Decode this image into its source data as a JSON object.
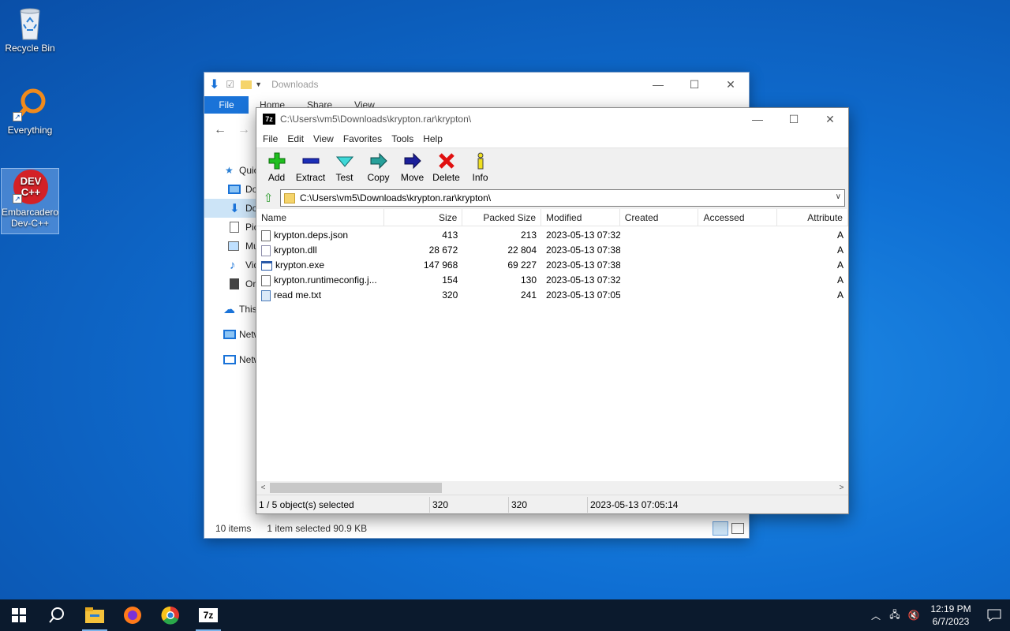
{
  "desktop": {
    "icons": [
      {
        "label": "Recycle Bin"
      },
      {
        "label": "Everything"
      },
      {
        "label": "Embarcadero Dev-C++"
      }
    ]
  },
  "explorer": {
    "title": "Downloads",
    "tabs": [
      "File",
      "Home",
      "Share",
      "View"
    ],
    "nav_items": [
      "Quic",
      "Do",
      "Do",
      "Pic",
      "Mu",
      "Vid",
      "One",
      "This",
      "Netw"
    ],
    "status_count": "10 items",
    "status_selected": "1 item selected  90.9 KB"
  },
  "zip": {
    "title": "C:\\Users\\vm5\\Downloads\\krypton.rar\\krypton\\",
    "menu": [
      "File",
      "Edit",
      "View",
      "Favorites",
      "Tools",
      "Help"
    ],
    "toolbar": [
      "Add",
      "Extract",
      "Test",
      "Copy",
      "Move",
      "Delete",
      "Info"
    ],
    "address": "C:\\Users\\vm5\\Downloads\\krypton.rar\\krypton\\",
    "columns": [
      "Name",
      "Size",
      "Packed Size",
      "Modified",
      "Created",
      "Accessed",
      "Attribute"
    ],
    "files": [
      {
        "name": "krypton.deps.json",
        "size": "413",
        "packed": "213",
        "modified": "2023-05-13 07:32",
        "attr": "A"
      },
      {
        "name": "krypton.dll",
        "size": "28 672",
        "packed": "22 804",
        "modified": "2023-05-13 07:38",
        "attr": "A"
      },
      {
        "name": "krypton.exe",
        "size": "147 968",
        "packed": "69 227",
        "modified": "2023-05-13 07:38",
        "attr": "A"
      },
      {
        "name": "krypton.runtimeconfig.j...",
        "size": "154",
        "packed": "130",
        "modified": "2023-05-13 07:32",
        "attr": "A"
      },
      {
        "name": "read me.txt",
        "size": "320",
        "packed": "241",
        "modified": "2023-05-13 07:05",
        "attr": "A"
      }
    ],
    "status": {
      "selection": "1 / 5 object(s) selected",
      "size": "320",
      "packed": "320",
      "modified": "2023-05-13 07:05:14"
    }
  },
  "taskbar": {
    "time": "12:19 PM",
    "date": "6/7/2023"
  }
}
